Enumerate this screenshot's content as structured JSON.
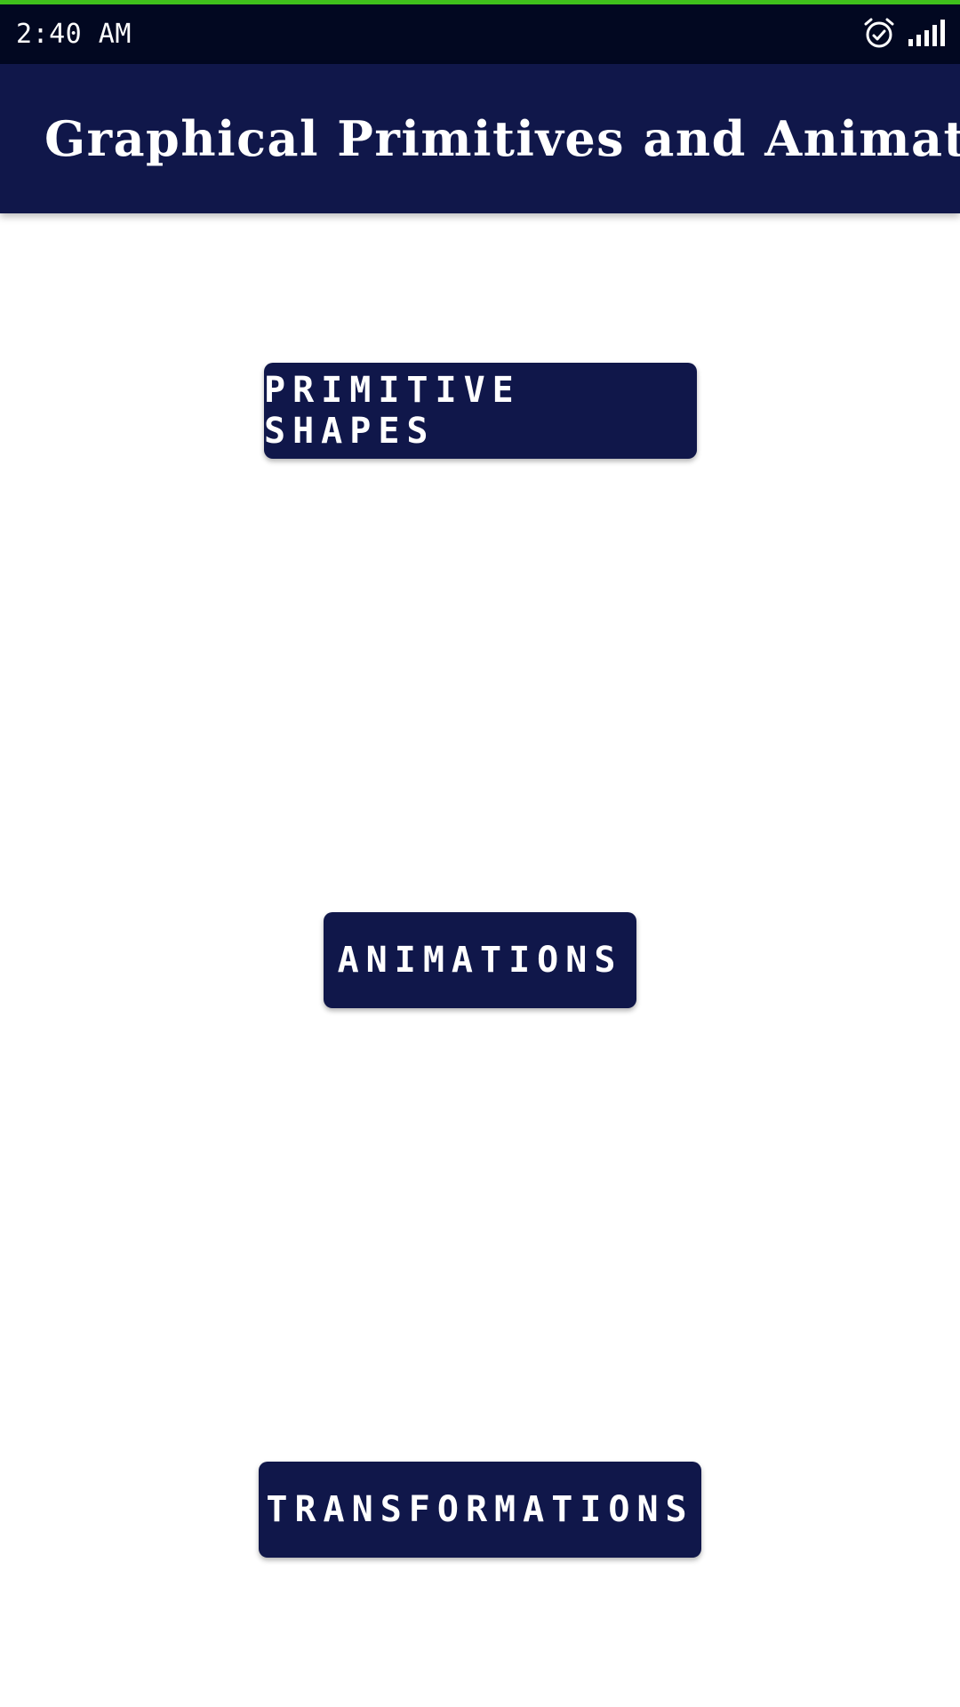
{
  "status_bar": {
    "time": "2:40 AM",
    "icons": [
      "alarm-icon",
      "signal-icon"
    ]
  },
  "app_bar": {
    "title": "Graphical Primitives and Animation"
  },
  "buttons": {
    "primitive_shapes": "PRIMITIVE SHAPES",
    "animations": "ANIMATIONS",
    "transformations": "TRANSFORMATIONS"
  },
  "colors": {
    "accent_top": "#3fc01c",
    "status_bar_bg": "#020821",
    "primary": "#10174a",
    "background": "#ffffff",
    "text_on_primary": "#ffffff"
  }
}
